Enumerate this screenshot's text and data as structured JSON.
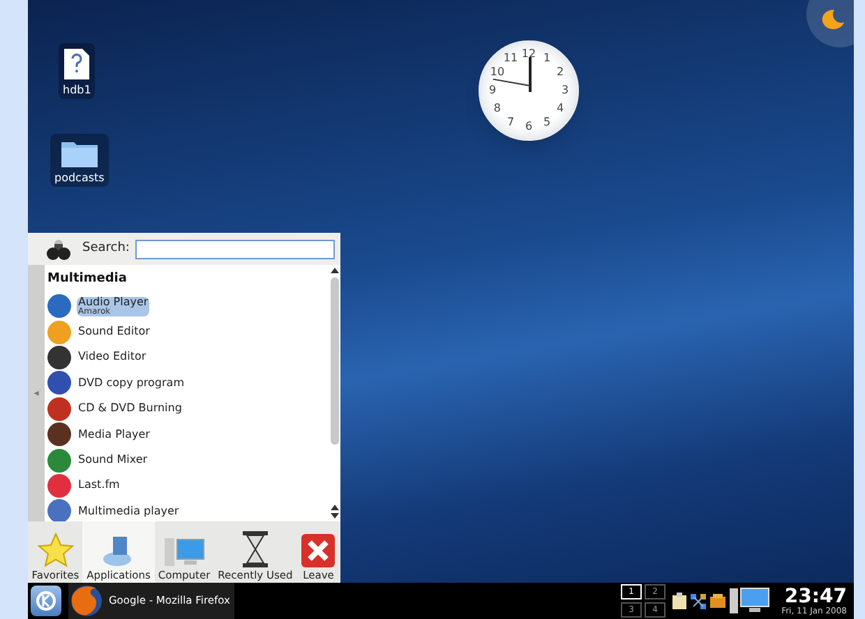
{
  "desktop_icons": [
    {
      "label": "hdb1",
      "kind": "drive"
    },
    {
      "label": "podcasts",
      "kind": "folder"
    }
  ],
  "clock_widget": {
    "numerals": [
      "12",
      "11",
      "1",
      "10",
      "2",
      "9",
      "3",
      "8",
      "4",
      "7",
      "5",
      "6"
    ]
  },
  "launcher": {
    "search_label": "Search:",
    "back_arrow": "◂",
    "category": "Multimedia",
    "items": [
      {
        "name": "Audio Player",
        "subtitle": "Amarok",
        "selected": true
      },
      {
        "name": "Sound Editor",
        "selected": false
      },
      {
        "name": "Video Editor",
        "selected": false
      },
      {
        "name": "DVD copy program",
        "selected": false
      },
      {
        "name": "CD & DVD Burning",
        "selected": false
      },
      {
        "name": "Media Player",
        "selected": false
      },
      {
        "name": "Sound Mixer",
        "selected": false
      },
      {
        "name": "Last.fm",
        "selected": false
      },
      {
        "name": "Multimedia player",
        "selected": false
      }
    ],
    "tabs": [
      {
        "label": "Favorites",
        "kind": "star",
        "selected": false
      },
      {
        "label": "Applications",
        "kind": "apps",
        "selected": true
      },
      {
        "label": "Computer",
        "kind": "computer",
        "selected": false
      },
      {
        "label": "Recently Used",
        "kind": "hourglass",
        "selected": false
      },
      {
        "label": "Leave",
        "kind": "leave",
        "selected": false
      }
    ]
  },
  "taskbar": {
    "task": "Google - Mozilla Firefox",
    "desktops": [
      {
        "label": "1",
        "selected": true
      },
      {
        "label": "2",
        "selected": false
      },
      {
        "label": "3",
        "selected": false
      },
      {
        "label": "4",
        "selected": false
      }
    ],
    "time": "23:47",
    "date": "Fri, 11 Jan 2008"
  }
}
